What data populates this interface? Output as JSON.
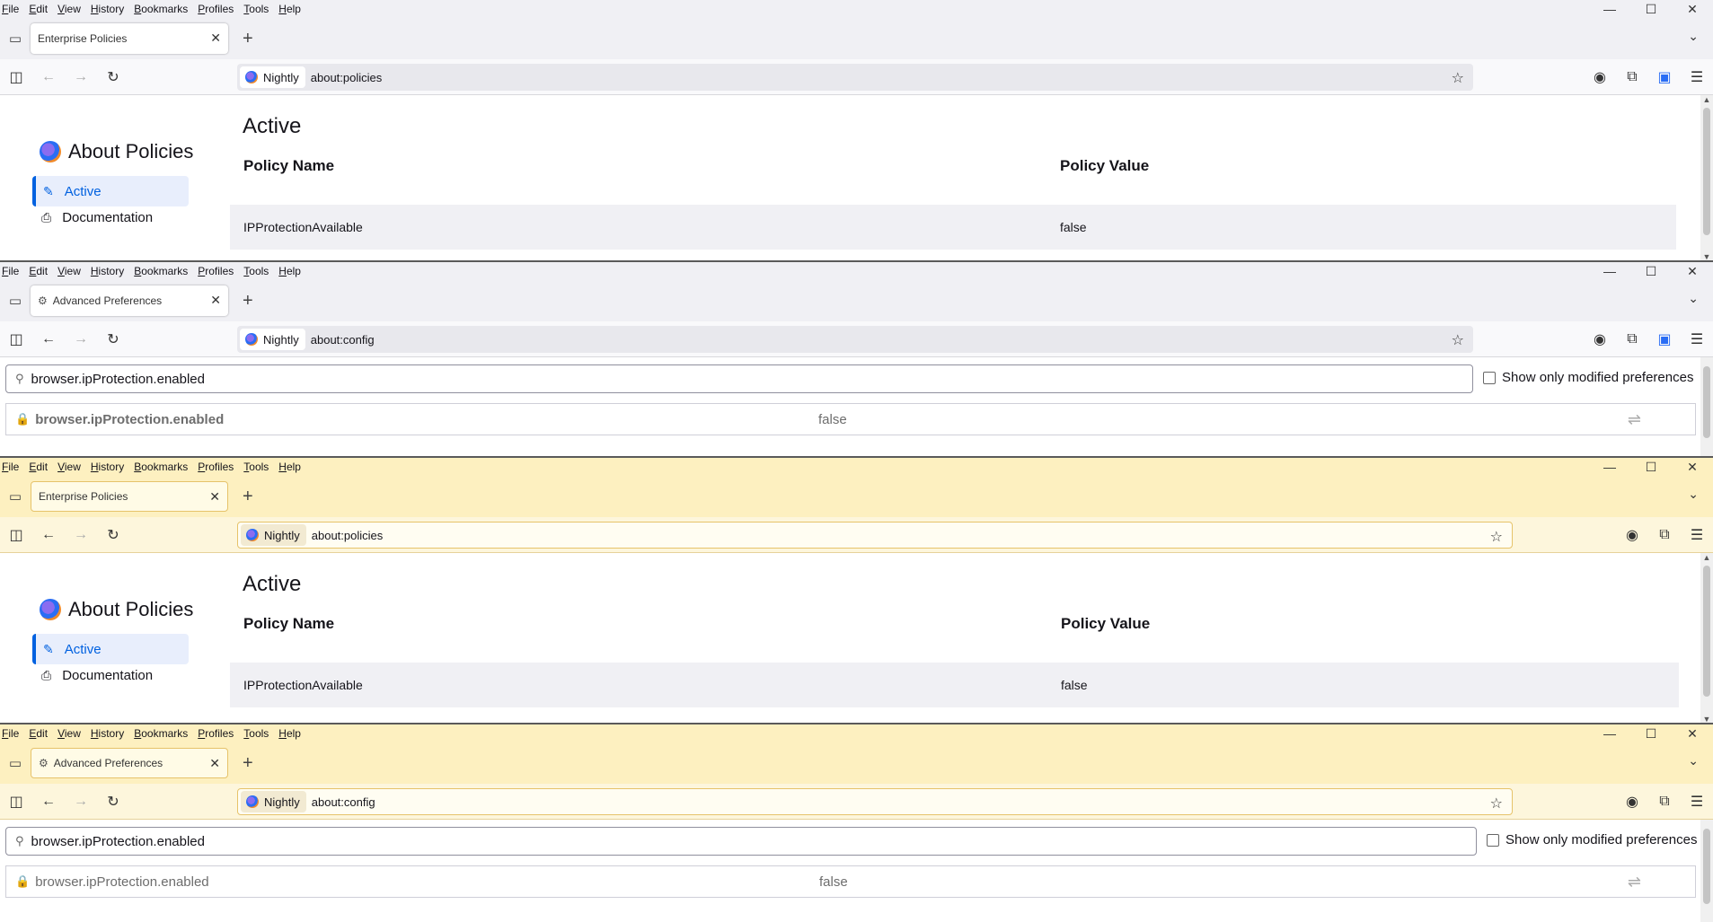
{
  "menu": [
    "File",
    "Edit",
    "View",
    "History",
    "Bookmarks",
    "Profiles",
    "Tools",
    "Help"
  ],
  "window_controls": {
    "minimize": "—",
    "maximize": "☐",
    "close": "✕"
  },
  "browser": {
    "identity_label": "Nightly"
  },
  "policies": {
    "tab_title": "Enterprise Policies",
    "url": "about:policies",
    "sidebar_title": "About Policies",
    "sidebar_active": "Active",
    "sidebar_documentation": "Documentation",
    "heading": "Active",
    "col_name": "Policy Name",
    "col_value": "Policy Value",
    "rows": [
      {
        "name": "IPProtectionAvailable",
        "value": "false"
      }
    ]
  },
  "config": {
    "tab_title": "Advanced Preferences",
    "url": "about:config",
    "search_value": "browser.ipProtection.enabled",
    "show_modified_label": "Show only modified preferences",
    "pref_name": "browser.ipProtection.enabled",
    "pref_value": "false"
  },
  "icons": {
    "tab_list": "▭",
    "close_tab": "✕",
    "new_tab": "+",
    "list_all_tabs": "⌄",
    "sidebar": "◫",
    "back": "←",
    "forward": "→",
    "reload": "↻",
    "bookmark_star": "☆",
    "account": "◉",
    "extensions": "⧉",
    "vpn": "▣",
    "menu": "☰",
    "search": "⚲",
    "lock": "🔒",
    "toggle": "⇌",
    "policy_active": "✎",
    "documentation": "⎙",
    "gear": "⚙"
  },
  "colors": {
    "accent": "#0061e0",
    "yellow_theme": "#fdf0c0",
    "default_theme": "#f0f0f4"
  }
}
